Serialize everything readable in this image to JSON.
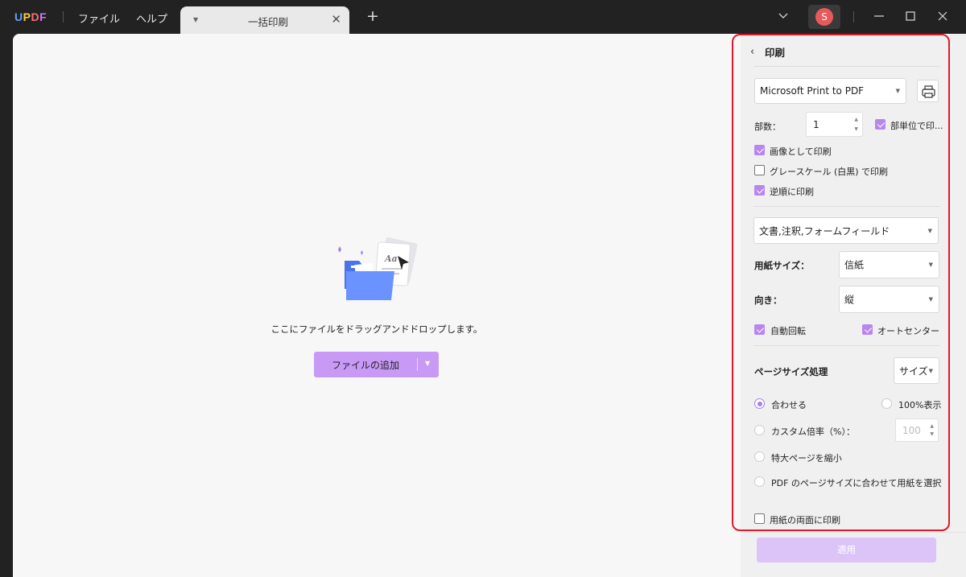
{
  "app": {
    "logo": "UPDF"
  },
  "menu": {
    "file": "ファイル",
    "help": "ヘルプ"
  },
  "tab": {
    "title": "一括印刷",
    "close_icon": "close-icon"
  },
  "avatar": {
    "letter": "S"
  },
  "main": {
    "drop_text": "ここにファイルをドラッグアンドドロップします。",
    "add_button": "ファイルの追加"
  },
  "panel": {
    "title": "印刷",
    "printer": "Microsoft Print to PDF",
    "copies_label": "部数：",
    "copies_value": "1",
    "collate_label": "部単位で印...",
    "print_as_image": "画像として印刷",
    "grayscale": "グレースケール (白黒) で印刷",
    "reverse": "逆順に印刷",
    "content_select": "文書,注釈,フォームフィールド",
    "paper_size_label": "用紙サイズ：",
    "paper_size_value": "信紙",
    "orientation_label": "向き：",
    "orientation_value": "縦",
    "auto_rotate": "自動回転",
    "auto_center": "オートセンター",
    "page_size_label": "ページサイズ処理",
    "page_size_value": "サイズ",
    "fit": "合わせる",
    "actual_size": "100%表示",
    "custom_scale": "カスタム倍率（%）：",
    "custom_scale_value": "100",
    "shrink_oversized": "特大ページを縮小",
    "choose_paper_by_pdf": "PDF のページサイズに合わせて用紙を選択",
    "duplex": "用紙の両面に印刷",
    "apply": "適用"
  },
  "states": {
    "collate": true,
    "print_as_image": true,
    "grayscale": false,
    "reverse": true,
    "auto_rotate": true,
    "auto_center": true,
    "duplex": false,
    "page_size_mode": "fit"
  },
  "colors": {
    "accent": "#b986ee",
    "highlight_border": "#e0182d",
    "avatar": "#e85a5a"
  }
}
